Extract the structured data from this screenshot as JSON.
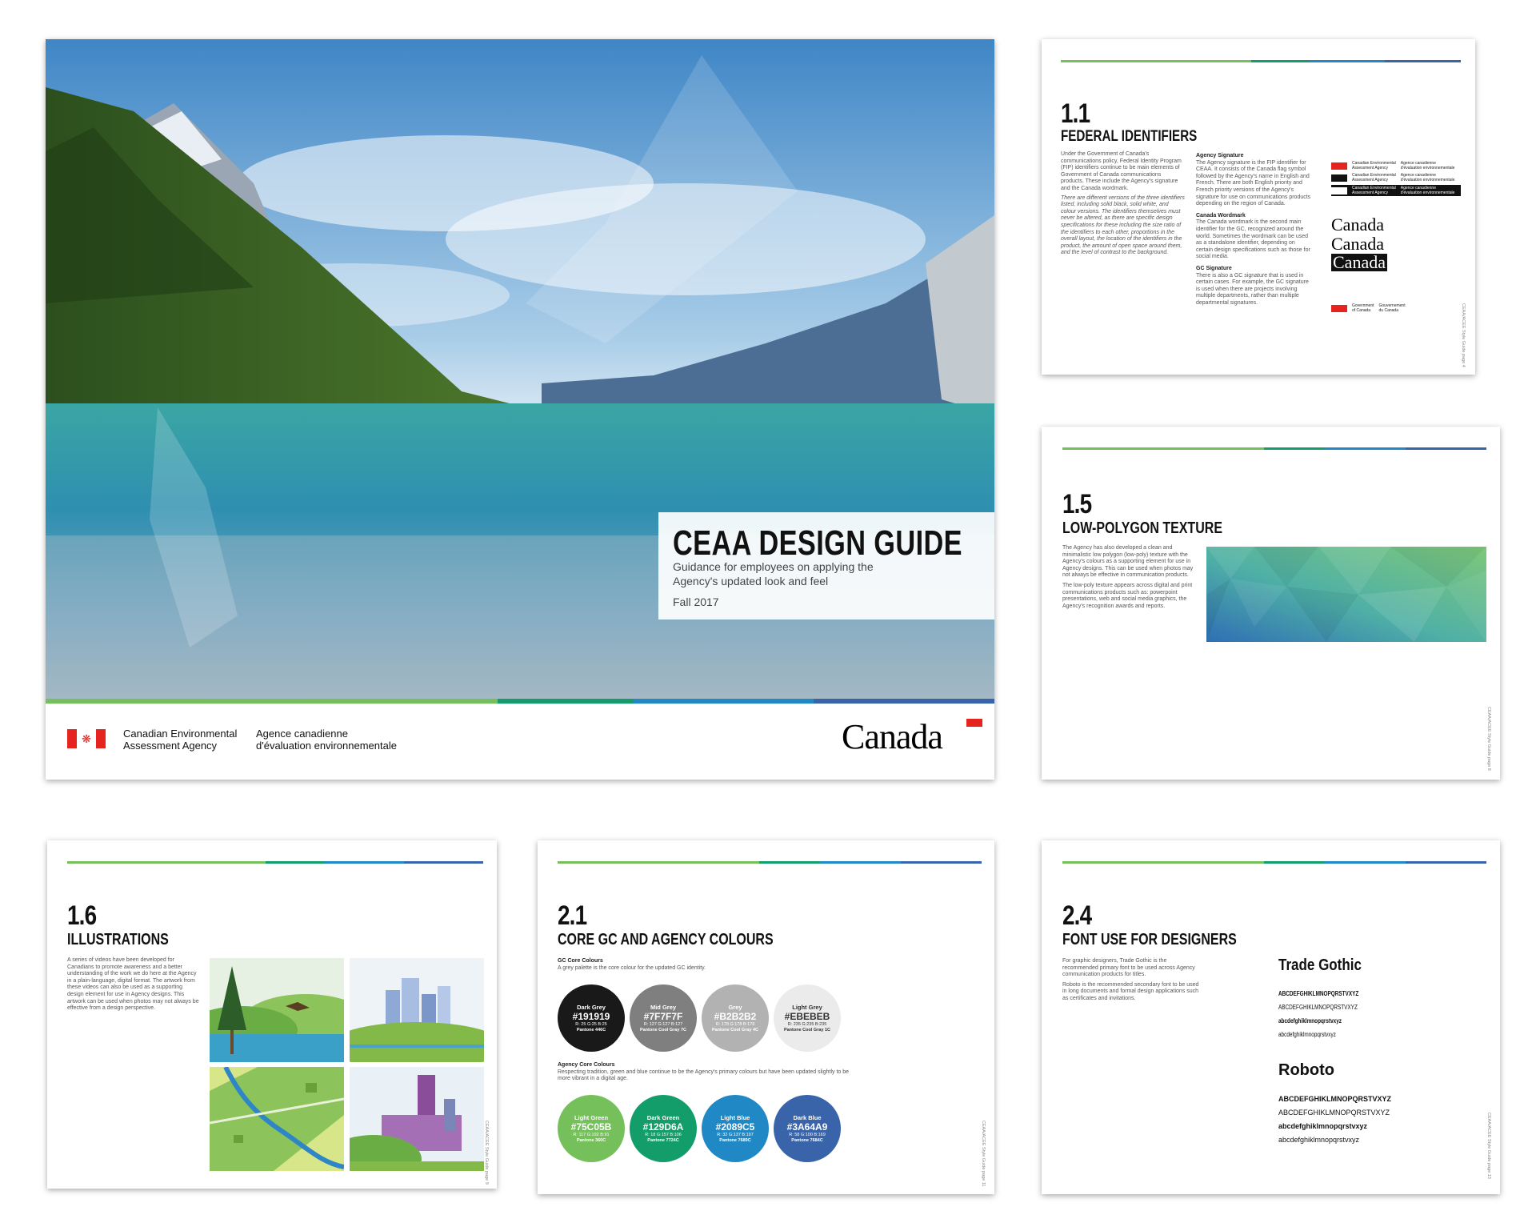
{
  "cover": {
    "title": "CEAA DESIGN GUIDE",
    "subtitle_line1": "Guidance for employees on applying the",
    "subtitle_line2": "Agency's updated look and feel",
    "date": "Fall 2017",
    "agency_en_line1": "Canadian Environmental",
    "agency_en_line2": "Assessment Agency",
    "agency_fr_line1": "Agence canadienne",
    "agency_fr_line2": "d'évaluation environnementale",
    "wordmark": "Canada"
  },
  "p11": {
    "num": "1.1",
    "title": "FEDERAL IDENTIFIERS",
    "intro": "Under the Government of Canada's communications policy, Federal Identity Program (FIP) identifiers continue to be main elements of Government of Canada communications products. These include the Agency's signature and the Canada wordmark.",
    "intro_italic": "There are different versions of the three identifiers listed, including solid black, solid white, and colour versions. The identifiers themselves must never be altered, as there are specific design specifications for these including the size ratio of the identifiers to each other, proportions in the overall layout, the location of the identifiers in the product, the amount of open space around them, and the level of contrast to the background.",
    "sig_head": "Agency Signature",
    "sig_text": "The Agency signature is the FIP identifier for CEAA. It consists of the Canada flag symbol followed by the Agency's name in English and French. There are both English priority and French priority versions of the Agency's signature for use on communications products depending on the region of Canada.",
    "wm_head": "Canada Wordmark",
    "wm_text": "The Canada wordmark is the second main identifier for the GC, recognized around the world. Sometimes the wordmark can be used as a standalone identifier, depending on certain design specifications such as those for social media.",
    "gc_head": "GC Signature",
    "gc_text": "There is also a GC signature that is used in certain cases. For example, the GC signature is used when there are projects involving multiple departments, rather than multiple departmental signatures.",
    "sig_en_1": "Canadian Environmental",
    "sig_en_2": "Assessment Agency",
    "sig_fr_1": "Agence canadienne",
    "sig_fr_2": "d'évaluation environnementale",
    "wordmark": "Canada",
    "gc_en_1": "Government",
    "gc_en_2": "of Canada",
    "gc_fr_1": "Gouvernement",
    "gc_fr_2": "du Canada",
    "footer": "CEAA/ACEE Style Guide page 4"
  },
  "p15": {
    "num": "1.5",
    "title": "LOW-POLYGON TEXTURE",
    "text1": "The Agency has also developed a clean and minimalistic low polygon (low-poly) texture with the Agency's colours as a supporting element for use in Agency designs. This can be used when photos may not always be effective in communication products.",
    "text2": "The low-poly texture appears across digital and print communications products such as: powerpoint presentations, web and social media graphics, the Agency's recognition awards and reports.",
    "footer": "CEAA/ACEE Style Guide page 8"
  },
  "p16": {
    "num": "1.6",
    "title": "ILLUSTRATIONS",
    "text": "A series of videos have been developed for Canadians to promote awareness and a better understanding of the work we do here at the Agency in a plain-language, digital format. The artwork from these videos can also be used as a supporting design element for use in Agency designs. This artwork can be used when photos may not always be effective from a design perspective.",
    "footer": "CEAA/ACEE Style Guide page 9"
  },
  "p21": {
    "num": "2.1",
    "title": "CORE GC AND AGENCY COLOURS",
    "gc_head": "GC Core Colours",
    "gc_text": "A grey palette is the core colour for the updated GC identity.",
    "agency_head": "Agency Core Colours",
    "agency_text": "Respecting tradition, green and blue continue to be the Agency's primary colours but have been updated slightly to be more vibrant in a digital age.",
    "gc_colours": [
      {
        "name": "Dark Grey",
        "hex": "#191919",
        "rgb": "R: 25 G:25 B:25",
        "pantone": "Pantone 446C",
        "fg": "#ffffff"
      },
      {
        "name": "Mid Grey",
        "hex": "#7F7F7F",
        "rgb": "R: 127 G:127 B:127",
        "pantone": "Pantone Cool Gray 7C",
        "fg": "#ffffff"
      },
      {
        "name": "Grey",
        "hex": "#B2B2B2",
        "rgb": "R: 178 G:178 B:178",
        "pantone": "Pantone Cool Gray 4C",
        "fg": "#ffffff"
      },
      {
        "name": "Light Grey",
        "hex": "#EBEBEB",
        "rgb": "R: 235 G:235 B:235",
        "pantone": "Pantone Cool Gray 1C",
        "fg": "#333333"
      }
    ],
    "agency_colours": [
      {
        "name": "Light Green",
        "hex": "#75C05B",
        "rgb": "R: 117 G:192 B:91",
        "pantone": "Pantone 360C",
        "fg": "#ffffff"
      },
      {
        "name": "Dark Green",
        "hex": "#129D6A",
        "rgb": "R: 18 G:157 B:106",
        "pantone": "Pantone 7724C",
        "fg": "#ffffff"
      },
      {
        "name": "Light Blue",
        "hex": "#2089C5",
        "rgb": "R: 32 G:137 B:197",
        "pantone": "Pantone 7689C",
        "fg": "#ffffff"
      },
      {
        "name": "Dark Blue",
        "hex": "#3A64A9",
        "rgb": "R: 58 G:100 B:169",
        "pantone": "Pantone 7684C",
        "fg": "#ffffff"
      }
    ],
    "footer": "CEAA/ACEE Style Guide page 11"
  },
  "p24": {
    "num": "2.4",
    "title": "FONT USE FOR DESIGNERS",
    "text1": "For graphic designers, Trade Gothic is the recommended primary font to be used across Agency communication products for titles.",
    "text2": "Roboto is the recommended secondary font to be used in long documents and formal design applications such as certificates and invitations.",
    "font1": "Trade Gothic",
    "font1_samples": [
      "ABCDEFGHIKLMNOPQRSTVXYZ",
      "ABCDEFGHIKLMNOPQRSTVXYZ",
      "abcdefghiklmnopqrstvxyz",
      "abcdefghiklmnopqrstvxyz"
    ],
    "font2": "Roboto",
    "font2_samples": [
      "ABCDEFGHIKLMNOPQRSTVXYZ",
      "ABCDEFGHIKLMNOPQRSTVXYZ",
      "abcdefghiklmnopqrstvxyz",
      "abcdefghiklmnopqrstvxyz"
    ],
    "footer": "CEAA/ACEE Style Guide page 13"
  }
}
